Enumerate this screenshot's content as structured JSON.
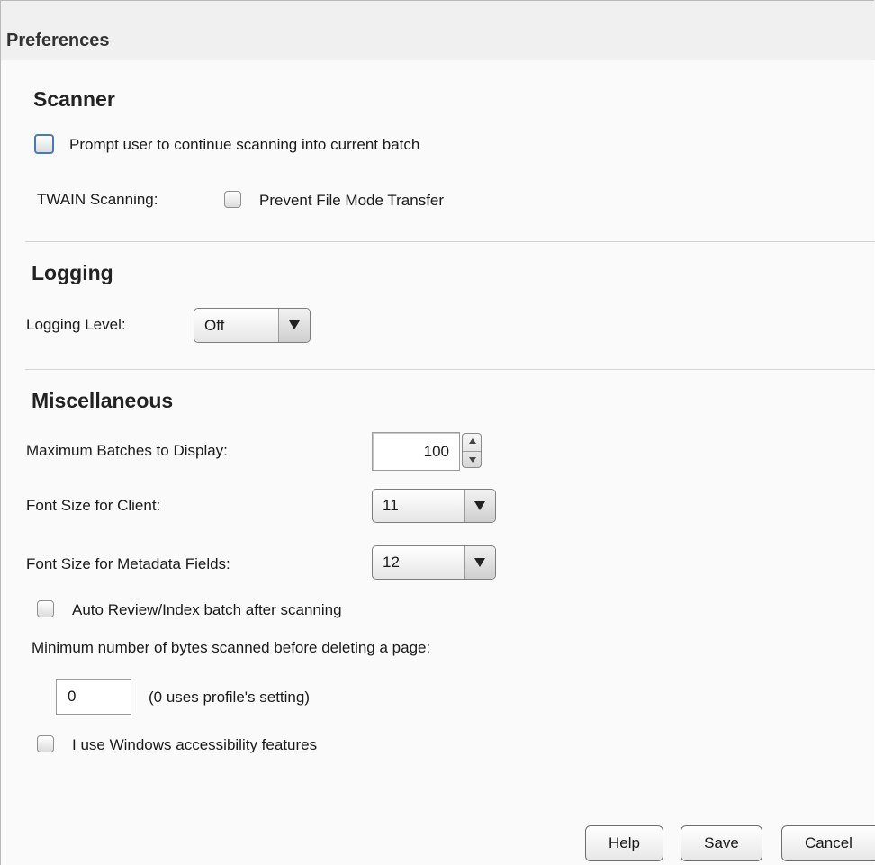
{
  "window": {
    "title": "Preferences"
  },
  "scanner": {
    "heading": "Scanner",
    "prompt_continue_label": "Prompt user to continue scanning into current batch",
    "prompt_continue_checked": false,
    "twain_label": "TWAIN Scanning:",
    "prevent_file_mode_label": "Prevent File Mode Transfer",
    "prevent_file_mode_checked": false
  },
  "logging": {
    "heading": "Logging",
    "level_label": "Logging Level:",
    "level_value": "Off"
  },
  "misc": {
    "heading": "Miscellaneous",
    "max_batches_label": "Maximum Batches to Display:",
    "max_batches_value": "100",
    "font_client_label": "Font Size for Client:",
    "font_client_value": "11",
    "font_metadata_label": "Font Size for Metadata Fields:",
    "font_metadata_value": "12",
    "auto_review_label": "Auto Review/Index batch after scanning",
    "auto_review_checked": false,
    "min_bytes_label": "Minimum number of bytes scanned before deleting a page:",
    "min_bytes_value": "0",
    "min_bytes_hint": "(0 uses profile's setting)",
    "accessibility_label": "I use Windows accessibility features",
    "accessibility_checked": false
  },
  "buttons": {
    "help": "Help",
    "save": "Save",
    "cancel": "Cancel"
  },
  "icons": {
    "dropdown": "chevron-down-icon",
    "spin_up": "spin-up-icon",
    "spin_down": "spin-down-icon"
  }
}
